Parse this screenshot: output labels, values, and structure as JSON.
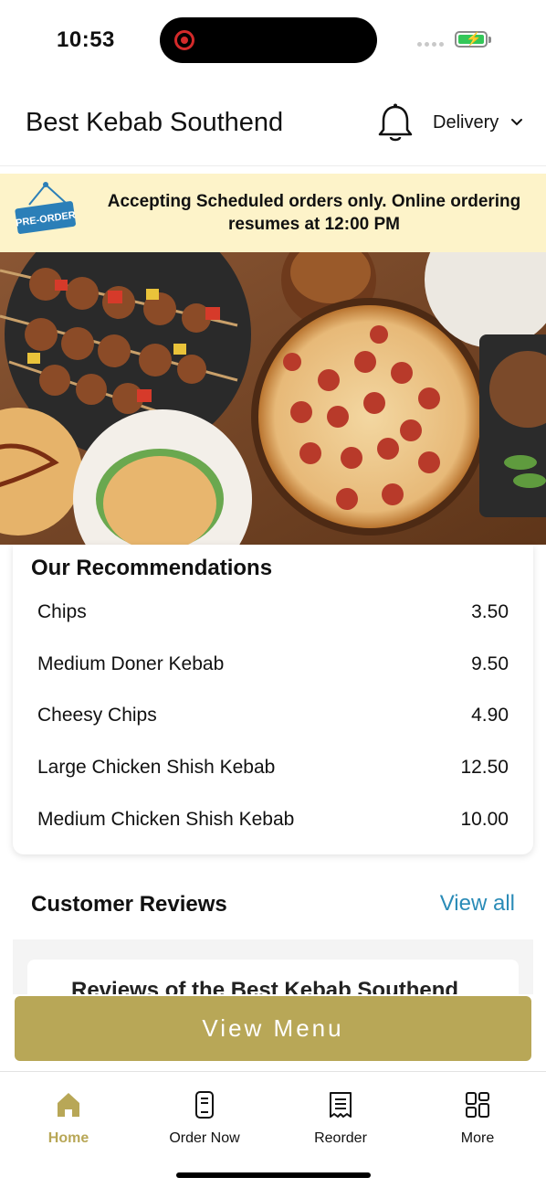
{
  "status_bar": {
    "time": "10:53"
  },
  "header": {
    "title": "Best Kebab Southend",
    "mode_label": "Delivery"
  },
  "banner": {
    "badge_text": "PRE-ORDER",
    "message": "Accepting Scheduled orders only. Online ordering resumes at 12:00 PM"
  },
  "recommendations": {
    "title": "Our Recommendations",
    "items": [
      {
        "name": "Chips",
        "price": "3.50"
      },
      {
        "name": "Medium Doner Kebab",
        "price": "9.50"
      },
      {
        "name": "Cheesy Chips",
        "price": "4.90"
      },
      {
        "name": "Large Chicken Shish Kebab",
        "price": "12.50"
      },
      {
        "name": "Medium Chicken Shish Kebab",
        "price": "10.00"
      }
    ]
  },
  "reviews": {
    "title": "Customer Reviews",
    "view_all": "View all",
    "card_preview": "Reviews of the Best Kebab Southend"
  },
  "cta": {
    "label": "View Menu"
  },
  "tabs": [
    {
      "label": "Home",
      "icon": "home-icon",
      "active": true
    },
    {
      "label": "Order Now",
      "icon": "phone-order-icon",
      "active": false
    },
    {
      "label": "Reorder",
      "icon": "receipt-icon",
      "active": false
    },
    {
      "label": "More",
      "icon": "grid-icon",
      "active": false
    }
  ],
  "colors": {
    "accent": "#b8a757",
    "link": "#2a8bb7",
    "banner_bg": "#fdf3c9",
    "badge": "#2b7fb8"
  }
}
